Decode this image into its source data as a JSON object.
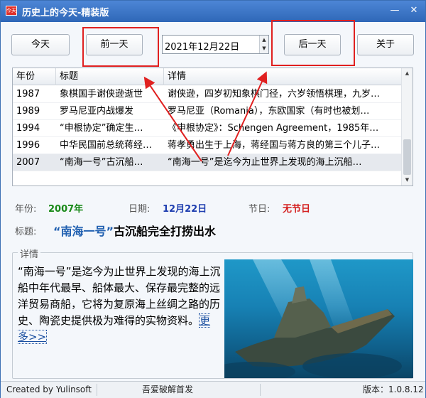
{
  "window": {
    "title": "历史上的今天-精装版",
    "icon_text": "今天"
  },
  "controls": {
    "minimize": "—",
    "close": "✕"
  },
  "toolbar": {
    "today": "今天",
    "prev_day": "前一天",
    "date_value": "2021年12月22日",
    "next_day": "后一天",
    "about": "关于"
  },
  "table": {
    "columns": [
      "年份",
      "标题",
      "详情"
    ],
    "rows": [
      {
        "year": "1987",
        "title": "象棋国手谢侠逊逝世",
        "detail": "谢侠逊，四岁初知象棋门径，六岁领悟棋理，九岁…"
      },
      {
        "year": "1989",
        "title": "罗马尼亚内战爆发",
        "detail": "罗马尼亚（Romania），东欧国家（有时也被划…"
      },
      {
        "year": "1994",
        "title": "“申根协定”确定生…",
        "detail": "《申根协定》：Schengen Agreement，1985年…"
      },
      {
        "year": "1996",
        "title": "中华民国前总统蒋经…",
        "detail": "蒋孝勇出生于上海，蒋经国与蒋方良的第三个儿子…"
      },
      {
        "year": "2007",
        "title": "“南海一号”古沉船…",
        "detail": "“南海一号”是迄今为止世界上发现的海上沉船…"
      }
    ],
    "selected_index": 4
  },
  "info": {
    "year_label": "年份:",
    "year_value": "2007年",
    "date_label": "日期:",
    "date_value": "12月22日",
    "holiday_label": "节日:",
    "holiday_value": "无节日",
    "title_label": "标题:",
    "title_highlight": "“南海一号”",
    "title_rest": "古沉船完全打捞出水"
  },
  "details": {
    "legend": "详情",
    "text": "“南海一号”是迄今为止世界上发现的海上沉船中年代最早、船体最大、保存最完整的远洋贸易商船，它将为复原海上丝绸之路的历史、陶瓷史提供极为难得的实物资料。",
    "more": "更多>>"
  },
  "status": {
    "created_by": "Created by Yulinsoft",
    "source": "吾爱破解首发",
    "version": "版本：1.0.8.12"
  },
  "colors": {
    "titlebar": "#2f67b8",
    "year_value": "#1a8a1a",
    "date_value": "#1f3fb0",
    "holiday_value": "#d42020",
    "annotation": "#e02020"
  }
}
